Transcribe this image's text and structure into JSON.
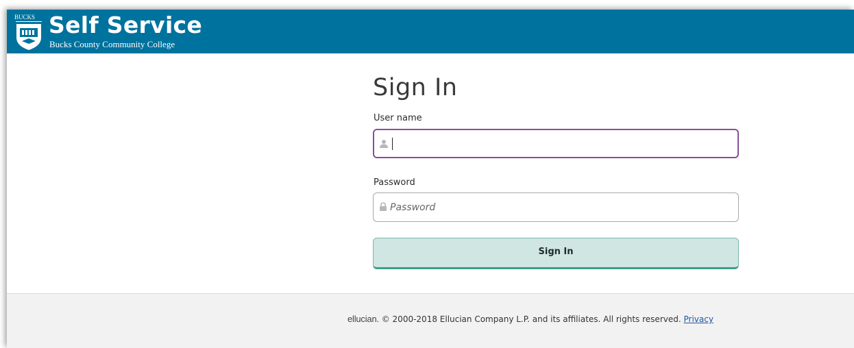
{
  "header": {
    "title": "Self Service",
    "subtitle": "Bucks County Community College",
    "crest_text": "BUCKS",
    "background_color": "#00729e"
  },
  "signin": {
    "heading": "Sign In",
    "username": {
      "label": "User name",
      "value": "",
      "icon": "user-icon",
      "focused": true
    },
    "password": {
      "label": "Password",
      "placeholder": "Password",
      "icon": "lock-icon"
    },
    "button_label": "Sign In",
    "button_color": "#cfe6e2"
  },
  "footer": {
    "logo_text": "ellucian.",
    "copyright": "© 2000-2018 Ellucian Company L.P. and its affiliates. All rights reserved.",
    "privacy_link": "Privacy"
  }
}
